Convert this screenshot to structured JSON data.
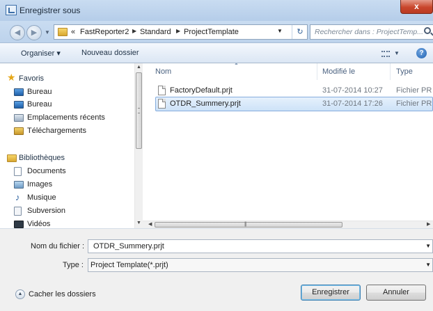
{
  "window": {
    "title": "Enregistrer sous",
    "close_label": "x"
  },
  "address_bar": {
    "prefix": "«",
    "path": [
      "FastReporter2",
      "Standard",
      "ProjectTemplate"
    ]
  },
  "search": {
    "placeholder": "Rechercher dans : ProjectTemp..."
  },
  "toolbar": {
    "organise_label": "Organiser ▾",
    "new_folder_label": "Nouveau dossier"
  },
  "nav": {
    "favorites_label": "Favoris",
    "favorites": [
      {
        "label": "Bureau",
        "icon": "desktop-icon"
      },
      {
        "label": "Bureau",
        "icon": "desktop-icon"
      },
      {
        "label": "Emplacements récents",
        "icon": "recent-places-icon"
      },
      {
        "label": "Téléchargements",
        "icon": "downloads-icon"
      }
    ],
    "libraries_label": "Bibliothèques",
    "libraries": [
      {
        "label": "Documents",
        "icon": "documents-icon"
      },
      {
        "label": "Images",
        "icon": "images-icon"
      },
      {
        "label": "Musique",
        "icon": "music-icon"
      },
      {
        "label": "Subversion",
        "icon": "subversion-icon"
      },
      {
        "label": "Vidéos",
        "icon": "videos-icon"
      }
    ]
  },
  "files": {
    "columns": [
      "Nom",
      "Modifié le",
      "Type"
    ],
    "rows": [
      {
        "name": "FactoryDefault.prjt",
        "modified": "31-07-2014 10:27",
        "type": "Fichier PR"
      },
      {
        "name": "OTDR_Summery.prjt",
        "modified": "31-07-2014 17:26",
        "type": "Fichier PR"
      }
    ],
    "selected_index": 1
  },
  "form": {
    "filename_label": "Nom du fichier :",
    "filename_value": "OTDR_Summery.prjt",
    "type_label": "Type :",
    "type_value": "Project Template(*.prjt)"
  },
  "footer": {
    "hide_folders_label": "Cacher les dossiers",
    "save_label": "Enregistrer",
    "cancel_label": "Annuler"
  },
  "colors": {
    "accent": "#3c7fb1",
    "selection": "#cde2f8",
    "close": "#c9462c"
  }
}
